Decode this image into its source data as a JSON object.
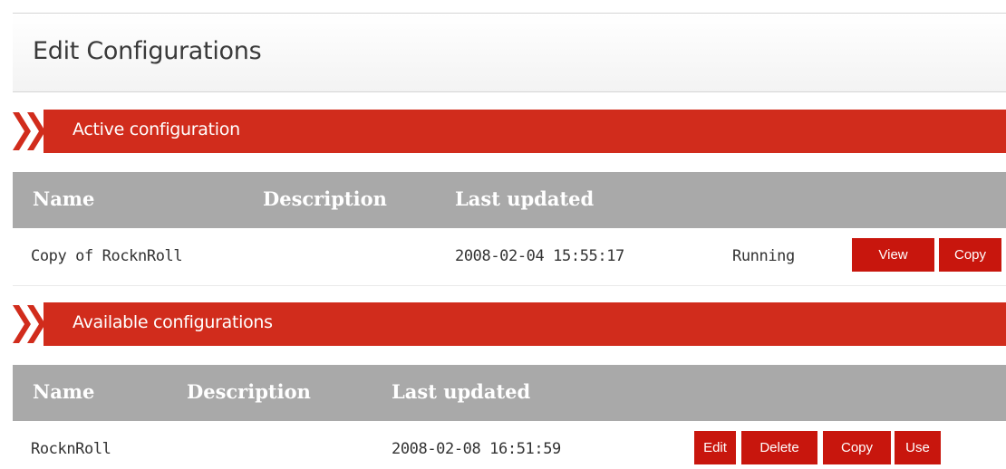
{
  "page": {
    "title": "Edit Configurations"
  },
  "active": {
    "section_label": "Active configuration",
    "columns": [
      "Name",
      "Description",
      "Last updated"
    ],
    "row": {
      "name": "Copy of RocknRoll",
      "description": "",
      "last_updated": "2008-02-04 15:55:17",
      "status": "Running",
      "actions": [
        "View",
        "Copy"
      ]
    }
  },
  "available": {
    "section_label": "Available configurations",
    "columns": [
      "Name",
      "Description",
      "Last updated"
    ],
    "row": {
      "name": "RocknRoll",
      "description": "",
      "last_updated": "2008-02-08 16:51:59",
      "actions": [
        "Edit",
        "Delete",
        "Copy",
        "Use"
      ]
    }
  },
  "colors": {
    "accent": "#d12c1c",
    "button": "#c8160d",
    "table_header": "#a9a9a9"
  },
  "icons": {
    "section_marker": "double-chevron-right-icon"
  }
}
